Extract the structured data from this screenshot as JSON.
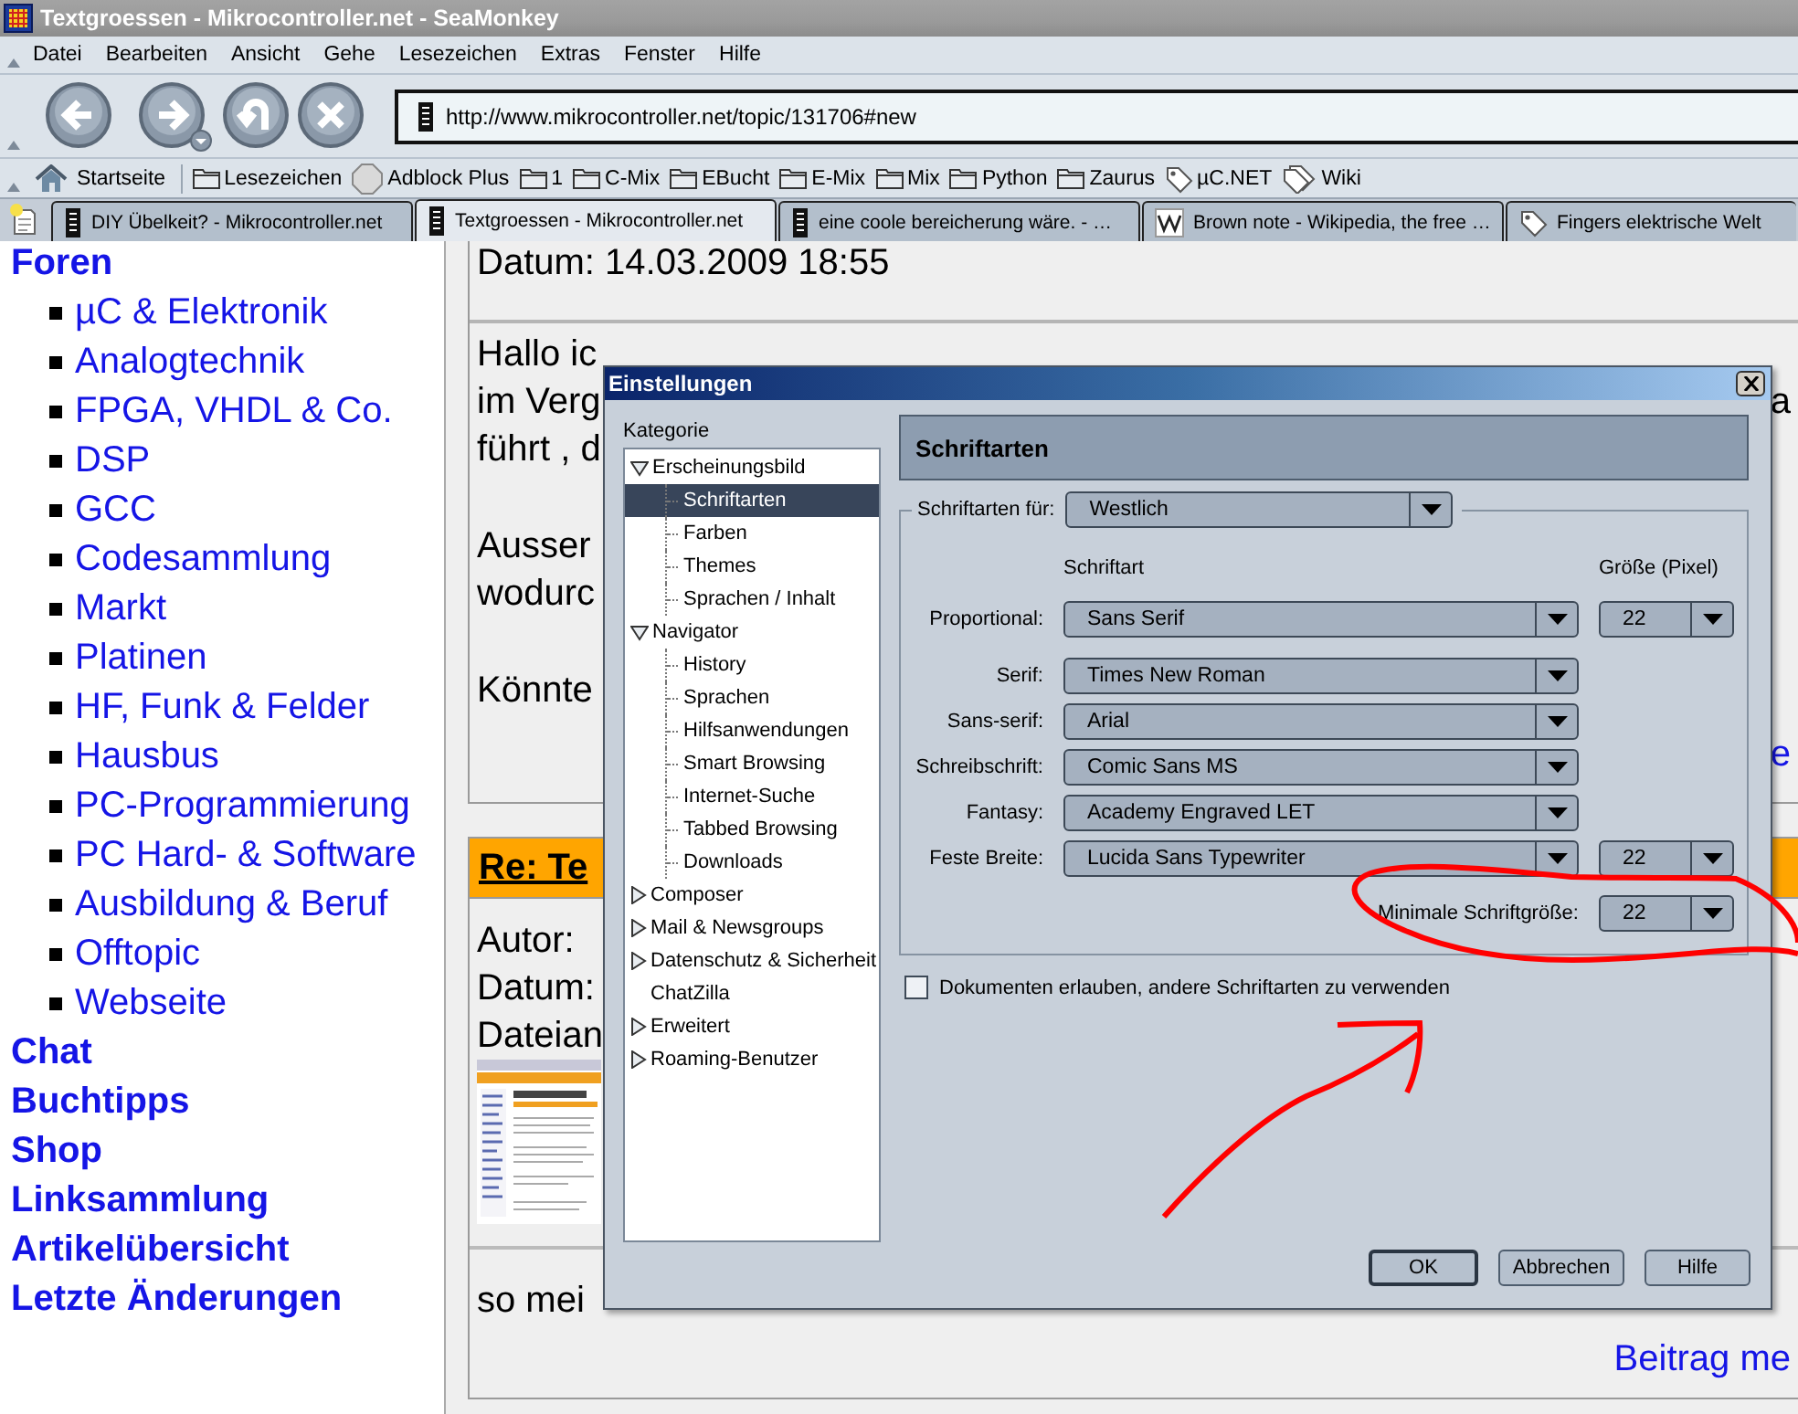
{
  "window": {
    "title": "Textgroessen - Mikrocontroller.net - SeaMonkey"
  },
  "menu": [
    "Datei",
    "Bearbeiten",
    "Ansicht",
    "Gehe",
    "Lesezeichen",
    "Extras",
    "Fenster",
    "Hilfe"
  ],
  "address": {
    "value": "http://www.mikrocontroller.net/topic/131706#new"
  },
  "bookmarks": [
    {
      "label": "Startseite",
      "kind": "home"
    },
    {
      "label": "Lesezeichen",
      "kind": "folder"
    },
    {
      "label": "Adblock Plus",
      "kind": "addon"
    },
    {
      "label": "1",
      "kind": "folder"
    },
    {
      "label": "C-Mix",
      "kind": "folder"
    },
    {
      "label": "EBucht",
      "kind": "folder"
    },
    {
      "label": "E-Mix",
      "kind": "folder"
    },
    {
      "label": "Mix",
      "kind": "folder"
    },
    {
      "label": "Python",
      "kind": "folder"
    },
    {
      "label": "Zaurus",
      "kind": "folder"
    },
    {
      "label": "µC.NET",
      "kind": "tag"
    },
    {
      "label": "Wiki",
      "kind": "tags"
    }
  ],
  "tabs": [
    {
      "label": "DIY Übelkeit? - Mikrocontroller.net",
      "kind": "site",
      "selected": false
    },
    {
      "label": "Textgroessen - Mikrocontroller.net",
      "kind": "site",
      "selected": true
    },
    {
      "label": "eine coole bereicherung wäre. - …",
      "kind": "site",
      "selected": false
    },
    {
      "label": "Brown note - Wikipedia, the free …",
      "kind": "wiki",
      "selected": false
    },
    {
      "label": "Fingers elektrische Welt",
      "kind": "tag",
      "selected": false
    }
  ],
  "sidebar": {
    "sections": [
      {
        "label": "Foren",
        "children": [
          {
            "label": "µC & Elektronik"
          },
          {
            "label": "Analogtechnik"
          },
          {
            "label": "FPGA, VHDL & Co."
          },
          {
            "label": "DSP"
          },
          {
            "label": "GCC"
          },
          {
            "label": "Codesammlung"
          },
          {
            "label": "Markt"
          },
          {
            "label": "Platinen"
          },
          {
            "label": "HF, Funk & Felder"
          },
          {
            "label": "Hausbus"
          },
          {
            "label": "PC-Programmierung"
          },
          {
            "label": "PC Hard- & Software"
          },
          {
            "label": "Ausbildung & Beruf"
          },
          {
            "label": "Offtopic"
          },
          {
            "label": "Webseite"
          }
        ]
      },
      {
        "label": "Chat"
      },
      {
        "label": "Buchtipps"
      },
      {
        "label": "Shop"
      },
      {
        "label": "Linksammlung"
      },
      {
        "label": "Artikelübersicht"
      },
      {
        "label": "Letzte Änderungen"
      }
    ]
  },
  "posts": [
    {
      "date": "Datum: 14.03.2009 18:55",
      "paragraphs": [
        [
          {
            "text": "Hallo ic"
          },
          {
            "text": "im Verg",
            "right": "a"
          },
          {
            "text": "führt , d"
          }
        ],
        [
          {
            "text": "Ausser"
          },
          {
            "text": "wodurc"
          }
        ],
        [
          {
            "text": "Könnte"
          }
        ]
      ],
      "link": "e"
    },
    {
      "title": "Re: Te",
      "meta": [
        "Autor:",
        "Datum:",
        "Dateian"
      ],
      "attachment": {
        "kind": "picture"
      },
      "paragraphs": [
        [
          {
            "text": "so mei"
          }
        ]
      ],
      "link": "Beitrag me"
    }
  ],
  "dialog": {
    "title": "Einstellungen",
    "category_label": "Kategorie",
    "tree": [
      {
        "label": "Erscheinungsbild",
        "kind": "group",
        "expanded": true,
        "selected": false,
        "children": [
          {
            "label": "Schriftarten",
            "selected": true
          },
          {
            "label": "Farben",
            "selected": false
          },
          {
            "label": "Themes",
            "selected": false
          },
          {
            "label": "Sprachen / Inhalt",
            "selected": false
          }
        ]
      },
      {
        "label": "Navigator",
        "kind": "group",
        "expanded": true,
        "selected": false,
        "children": [
          {
            "label": "History",
            "selected": false
          },
          {
            "label": "Sprachen",
            "selected": false
          },
          {
            "label": "Hilfsanwendungen",
            "selected": false
          },
          {
            "label": "Smart Browsing",
            "selected": false
          },
          {
            "label": "Internet-Suche",
            "selected": false
          },
          {
            "label": "Tabbed Browsing",
            "selected": false
          },
          {
            "label": "Downloads",
            "selected": false
          }
        ]
      },
      {
        "label": "Composer",
        "kind": "group",
        "expanded": false,
        "selected": false
      },
      {
        "label": "Mail & Newsgroups",
        "kind": "group",
        "expanded": false,
        "selected": false
      },
      {
        "label": "Datenschutz & Sicherheit",
        "kind": "group",
        "expanded": false,
        "selected": false
      },
      {
        "label": "ChatZilla",
        "kind": "leaf",
        "selected": false
      },
      {
        "label": "Erweitert",
        "kind": "group",
        "expanded": false,
        "selected": false
      },
      {
        "label": "Roaming-Benutzer",
        "kind": "group",
        "expanded": false,
        "selected": false
      }
    ],
    "panel": {
      "title": "Schriftarten",
      "language": {
        "label": "Schriftarten für:",
        "value": "Westlich"
      },
      "font_header": "Schriftart",
      "size_header": "Größe (Pixel)",
      "fonts": [
        {
          "label": "Proportional:",
          "value": "Sans Serif",
          "size": "22"
        },
        {
          "label": "Serif:",
          "value": "Times New Roman"
        },
        {
          "label": "Sans-serif:",
          "value": "Arial"
        },
        {
          "label": "Schreibschrift:",
          "value": "Comic Sans MS"
        },
        {
          "label": "Fantasy:",
          "value": "Academy Engraved LET"
        },
        {
          "label": "Feste Breite:",
          "value": "Lucida Sans Typewriter",
          "size": "22"
        }
      ],
      "minimum": {
        "label": "Minimale Schriftgröße:",
        "value": "22"
      },
      "allow_documents": {
        "label": "Dokumenten erlauben, andere Schriftarten zu verwenden",
        "checked": false
      }
    },
    "buttons": [
      {
        "label": "OK",
        "default": true
      },
      {
        "label": "Abbrechen",
        "default": false
      },
      {
        "label": "Hilfe",
        "default": false
      }
    ]
  }
}
